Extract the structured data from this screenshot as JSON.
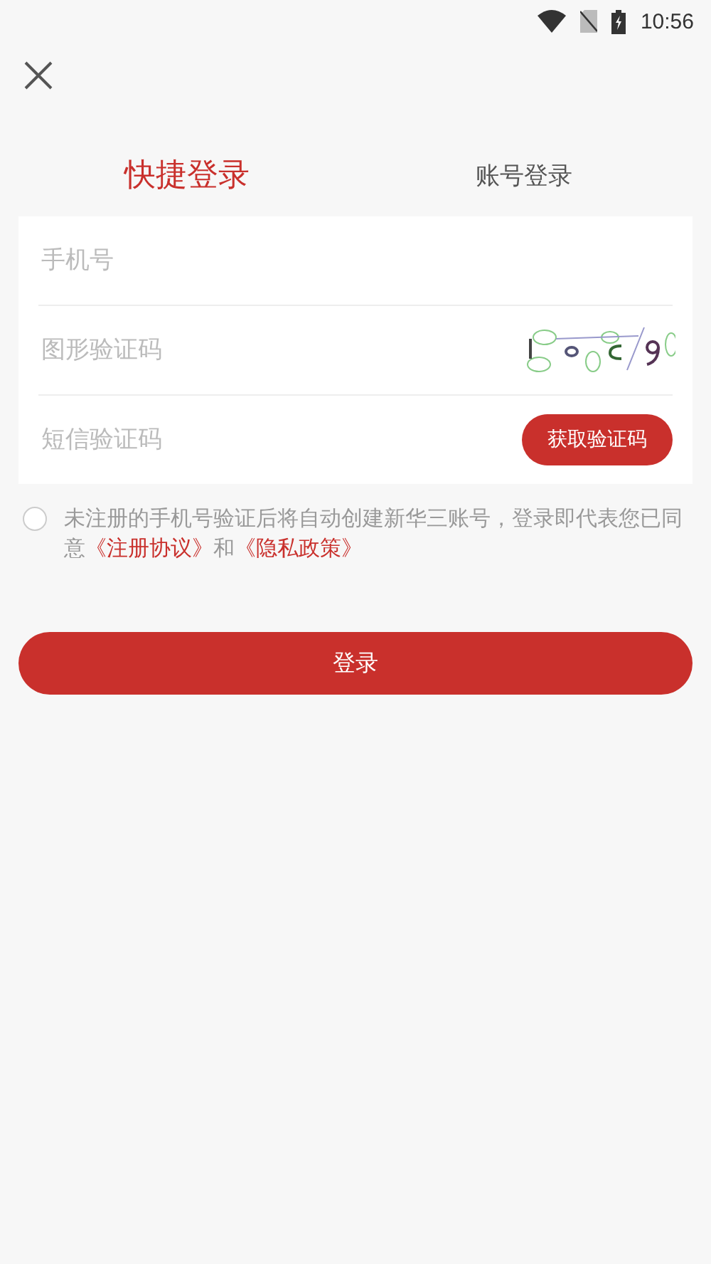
{
  "status_bar": {
    "time": "10:56"
  },
  "tabs": [
    {
      "label": "快捷登录",
      "selected": true
    },
    {
      "label": "账号登录",
      "selected": false
    }
  ],
  "form": {
    "fields": [
      {
        "kind": "text",
        "placeholder": "手机号"
      },
      {
        "kind": "captcha",
        "placeholder": "图形验证码"
      },
      {
        "kind": "sms",
        "placeholder": "短信验证码",
        "button": "获取验证码"
      }
    ]
  },
  "agreement": {
    "checked": false,
    "parts": [
      {
        "kind": "text",
        "text": "未注册的手机号验证后将自动创建新华三账号，登录即代表您已同意"
      },
      {
        "kind": "link",
        "text": "《注册协议》"
      },
      {
        "kind": "text",
        "text": "和"
      },
      {
        "kind": "link",
        "text": "《隐私政策》"
      }
    ]
  },
  "login_button": {
    "label": "登录"
  }
}
